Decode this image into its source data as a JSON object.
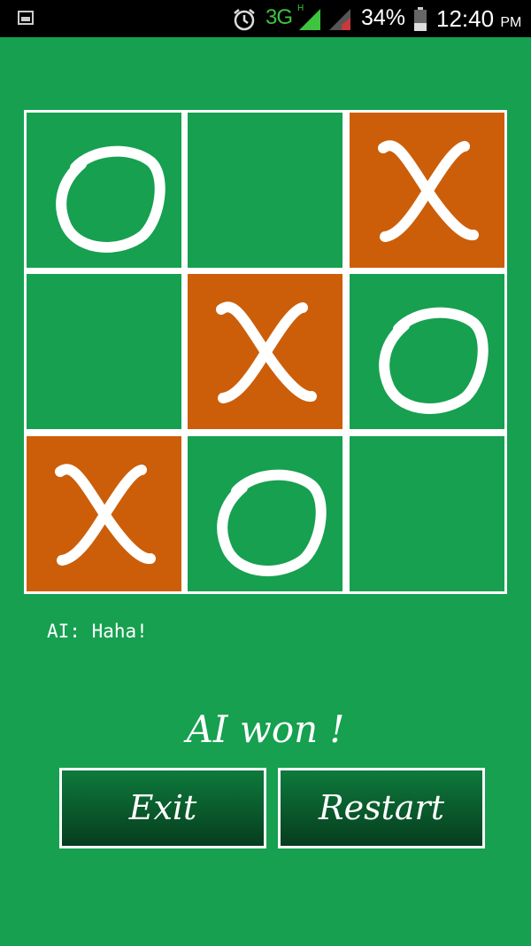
{
  "status_bar": {
    "network": "3G",
    "network_sub": "H",
    "battery": "34%",
    "time": "12:40",
    "ampm": "PM"
  },
  "board": {
    "cells": [
      "O",
      "",
      "X",
      "",
      "X",
      "O",
      "X",
      "O",
      ""
    ],
    "winning_cells": [
      2,
      4,
      6
    ],
    "colors": {
      "background": "#16a050",
      "win": "#cc5e09",
      "grid": "#ffffff"
    }
  },
  "ai_message": "AI: Haha!",
  "result": "AI won !",
  "buttons": {
    "exit": "Exit",
    "restart": "Restart"
  }
}
